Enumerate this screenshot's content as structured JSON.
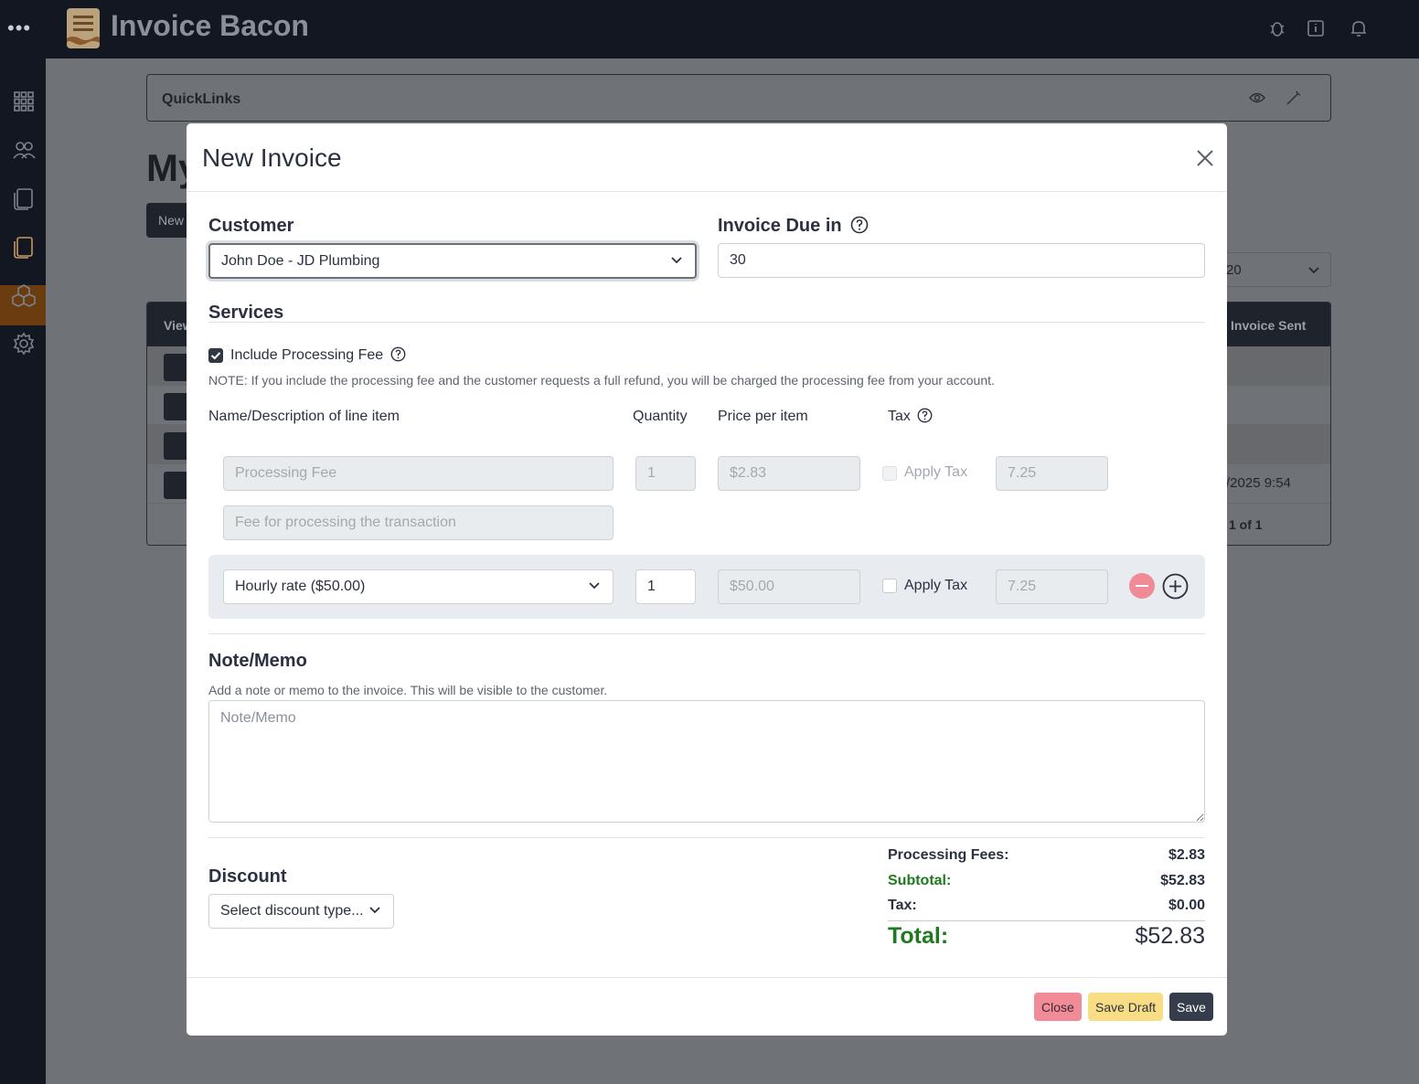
{
  "app": {
    "name": "Invoice Bacon",
    "quicklinks_label": "QuickLinks",
    "heading_fragment": "My",
    "new_button_fragment": "New",
    "table_header_left": "View",
    "table_header_right": "Invoice Sent",
    "select_fragment": "20",
    "date_fragment": "/2025 9:54",
    "pagination": "1 of 1"
  },
  "modal": {
    "title": "New Invoice",
    "customer": {
      "label": "Customer",
      "value": "John Doe - JD Plumbing"
    },
    "due": {
      "label": "Invoice Due in",
      "value": "30"
    },
    "services": {
      "title": "Services",
      "include_fee_label": "Include Processing Fee",
      "include_fee_checked": true,
      "note": "NOTE: If you include the processing fee and the customer requests a full refund, you will be charged the processing fee from your account.",
      "columns": {
        "name": "Name/Description of line item",
        "quantity": "Quantity",
        "price": "Price per item",
        "tax": "Tax"
      },
      "fee_item": {
        "name": "Processing Fee",
        "description": "Fee for processing the transaction",
        "quantity": "1",
        "price": "$2.83",
        "apply_tax_label": "Apply Tax",
        "tax_rate": "7.25"
      },
      "line_item": {
        "service": "Hourly rate ($50.00)",
        "quantity": "1",
        "price": "$50.00",
        "apply_tax_label": "Apply Tax",
        "tax_rate": "7.25"
      }
    },
    "memo": {
      "title": "Note/Memo",
      "help": "Add a note or memo to the invoice. This will be visible to the customer.",
      "placeholder": "Note/Memo"
    },
    "discount": {
      "title": "Discount",
      "placeholder": "Select discount type..."
    },
    "totals": {
      "processing_label": "Processing Fees:",
      "processing_value": "$2.83",
      "subtotal_label": "Subtotal:",
      "subtotal_value": "$52.83",
      "tax_label": "Tax:",
      "tax_value": "$0.00",
      "total_label": "Total:",
      "total_value": "$52.83"
    },
    "buttons": {
      "close": "Close",
      "save_draft": "Save Draft",
      "save": "Save"
    }
  },
  "colors": {
    "accent_dark": "#353d4c",
    "danger": "#f28b98",
    "warning": "#f8dd85",
    "success_text": "#1f7a1f"
  }
}
